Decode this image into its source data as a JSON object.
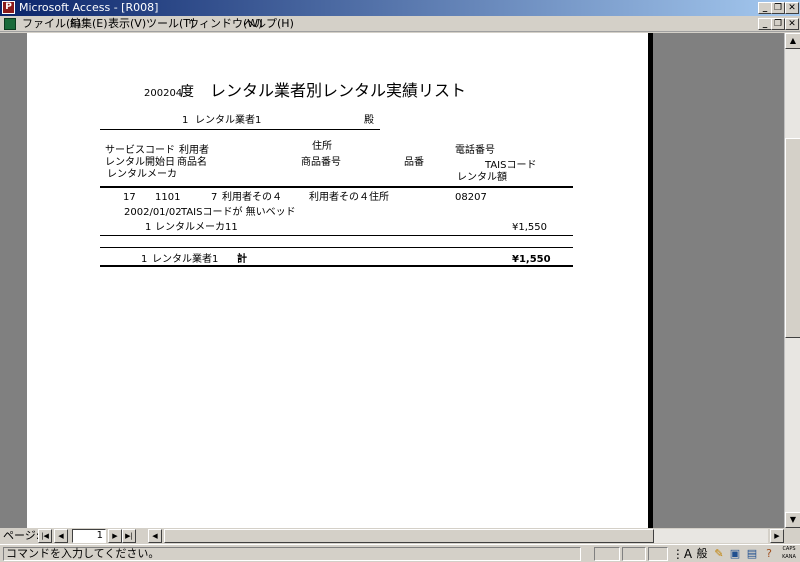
{
  "window": {
    "app_title": "Microsoft Access - [R008]",
    "app_icon_glyph": "P"
  },
  "menu": {
    "items": [
      "ファイル(F)",
      "編集(E)",
      "表示(V)",
      "ツール(T)",
      "ウィンドウ(W)",
      "ヘルプ(H)"
    ]
  },
  "report": {
    "year": "200204",
    "year_suffix": "度",
    "title": "レンタル業者別レンタル実績リスト",
    "vendor_no": "1",
    "vendor_name": "レンタル業者1",
    "honorific": "殿",
    "headers": {
      "service_code": "サービスコード",
      "user": "利用者",
      "address": "住所",
      "phone": "電話番号",
      "rental_start": "レンタル開始日",
      "product_name": "商品名",
      "product_number": "商品番号",
      "item_number": "品番",
      "tais_code": "TAISコード",
      "rental_maker": "レンタルメーカ",
      "rental_amount": "レンタル額"
    },
    "row": {
      "service_code": "17",
      "sub_code": "1101",
      "user_no": "7",
      "user_name": "利用者その４",
      "address": "利用者その４住所",
      "phone": "08207",
      "start_date": "2002/01/02",
      "product": "TAISコードが 無いベッド",
      "maker_no": "1",
      "maker_name": "レンタルメーカ11",
      "amount": "¥1,550"
    },
    "total": {
      "vendor_no": "1",
      "vendor_name": "レンタル業者1",
      "label": "計",
      "amount": "¥1,550"
    }
  },
  "navigation": {
    "page_label": "ページ:",
    "current_page": "1"
  },
  "status": {
    "message": "コマンドを入力してください。",
    "ime_mode": "般",
    "caps": "CAPS",
    "kana": "KANA"
  }
}
